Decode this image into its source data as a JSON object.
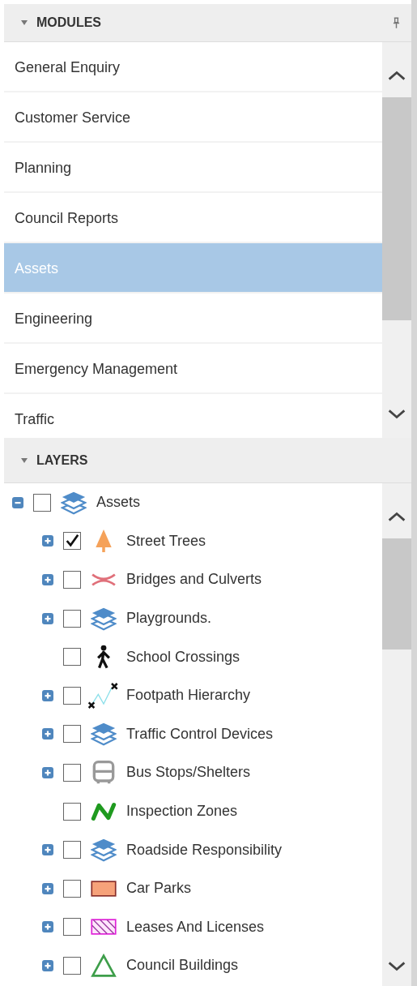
{
  "modules": {
    "title": "MODULES",
    "expanded": true,
    "items": [
      {
        "label": "General Enquiry",
        "selected": false
      },
      {
        "label": "Customer Service",
        "selected": false
      },
      {
        "label": "Planning",
        "selected": false
      },
      {
        "label": "Council Reports",
        "selected": false
      },
      {
        "label": "Assets",
        "selected": true
      },
      {
        "label": "Engineering",
        "selected": false
      },
      {
        "label": "Emergency Management",
        "selected": false
      },
      {
        "label": "Traffic",
        "selected": false
      }
    ]
  },
  "layers": {
    "title": "LAYERS",
    "expanded": true,
    "tree": [
      {
        "label": "Assets",
        "kind": "layers",
        "has_children": true,
        "expanded": true,
        "checked": false,
        "children": [
          {
            "label": "Street Trees",
            "kind": "tree",
            "has_children": true,
            "expanded": false,
            "checked": true
          },
          {
            "label": "Bridges and Culverts",
            "kind": "bridge",
            "has_children": true,
            "expanded": false,
            "checked": false
          },
          {
            "label": "Playgrounds.",
            "kind": "layers",
            "has_children": true,
            "expanded": false,
            "checked": false
          },
          {
            "label": "School Crossings",
            "kind": "walker",
            "has_children": false,
            "checked": false
          },
          {
            "label": "Footpath Hierarchy",
            "kind": "footpath",
            "has_children": true,
            "expanded": false,
            "checked": false
          },
          {
            "label": "Traffic Control Devices",
            "kind": "layers",
            "has_children": true,
            "expanded": false,
            "checked": false
          },
          {
            "label": "Bus Stops/Shelters",
            "kind": "bus",
            "has_children": true,
            "expanded": false,
            "checked": false
          },
          {
            "label": "Inspection Zones",
            "kind": "zigzag",
            "has_children": false,
            "checked": false
          },
          {
            "label": "Roadside Responsibility",
            "kind": "layers",
            "has_children": true,
            "expanded": false,
            "checked": false
          },
          {
            "label": "Car Parks",
            "kind": "area",
            "has_children": true,
            "expanded": false,
            "checked": false
          },
          {
            "label": "Leases And Licenses",
            "kind": "hatch",
            "has_children": true,
            "expanded": false,
            "checked": false
          },
          {
            "label": "Council Buildings",
            "kind": "triangle",
            "has_children": true,
            "expanded": false,
            "checked": false
          }
        ]
      }
    ]
  }
}
